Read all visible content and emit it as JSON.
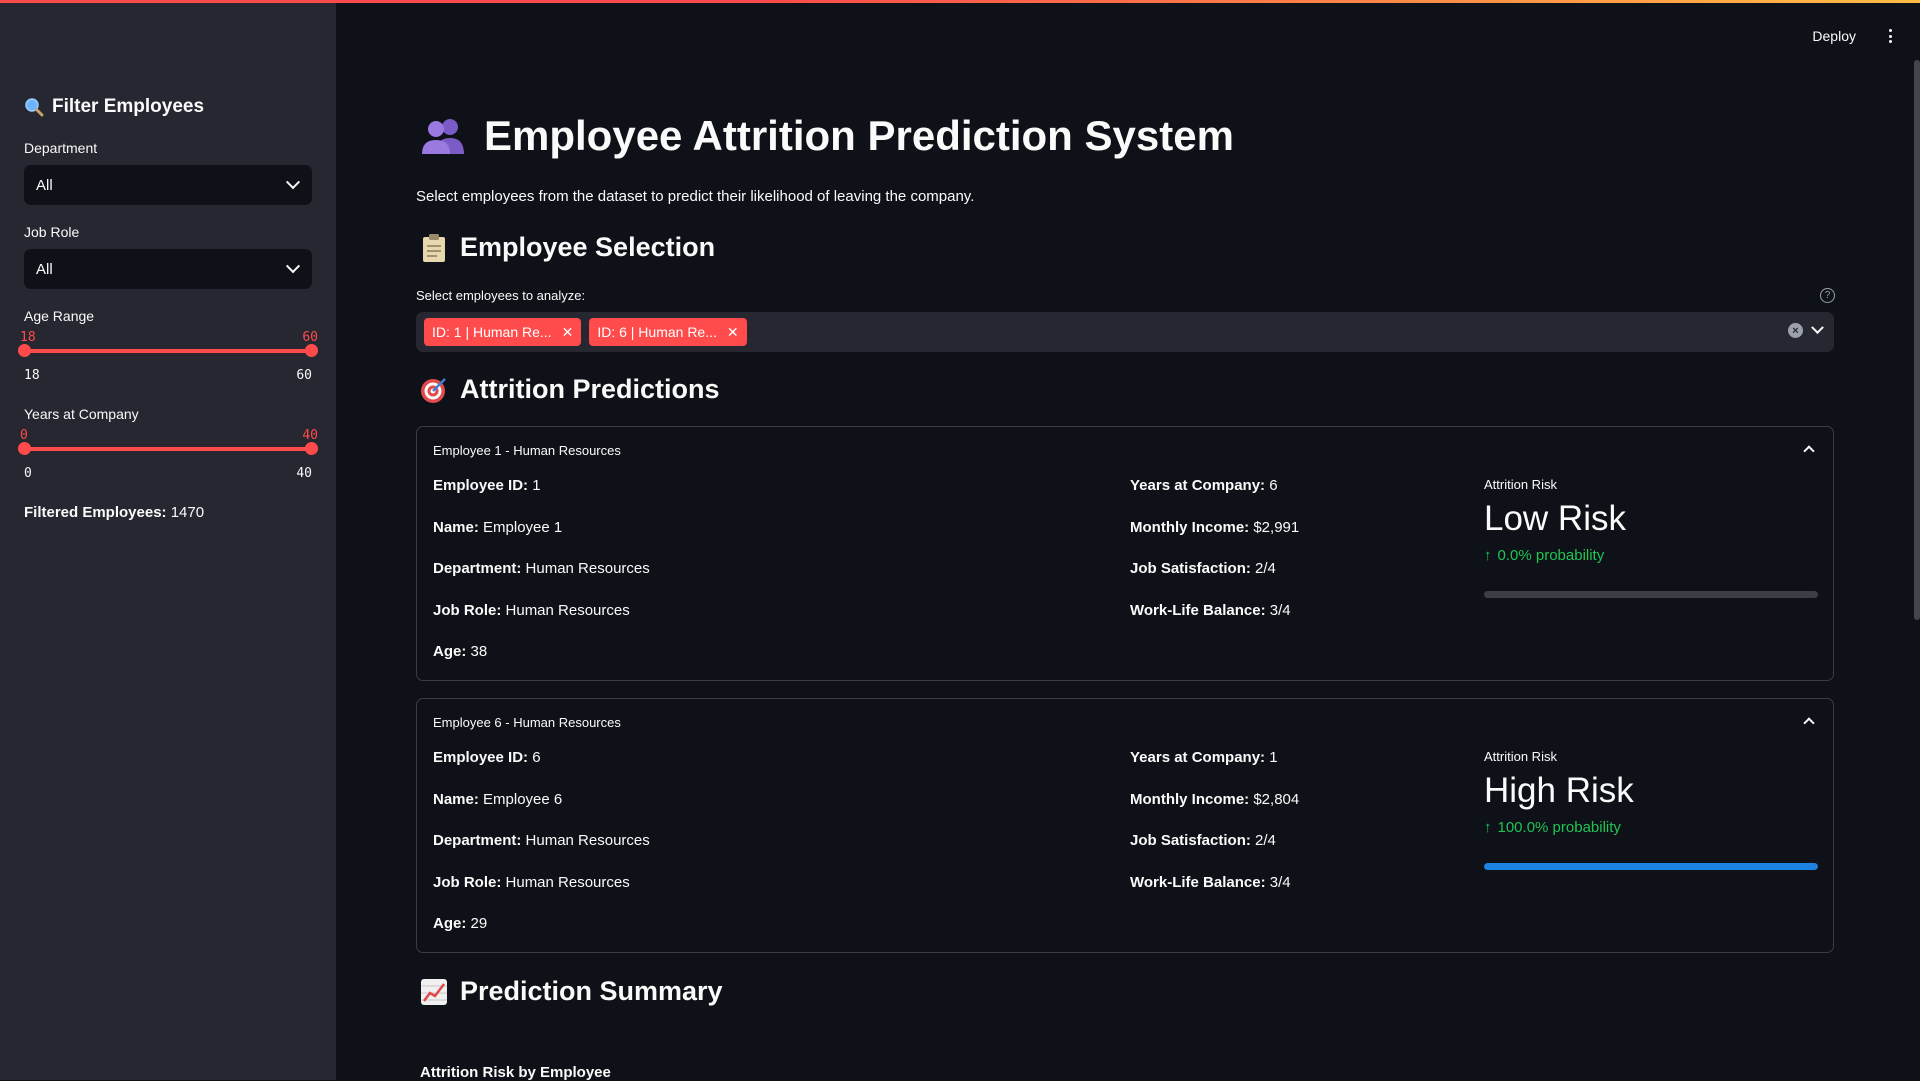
{
  "header": {
    "deploy_label": "Deploy",
    "menu_icon": "kebab-menu-icon"
  },
  "sidebar": {
    "title": "Filter Employees",
    "title_icon": "magnifier-icon",
    "department": {
      "label": "Department",
      "value": "All"
    },
    "job_role": {
      "label": "Job Role",
      "value": "All"
    },
    "age_range": {
      "label": "Age Range",
      "low": "18",
      "high": "60",
      "min": "18",
      "max": "60"
    },
    "years_at_company": {
      "label": "Years at Company",
      "low": "0",
      "high": "40",
      "min": "0",
      "max": "40"
    },
    "filtered_label": "Filtered Employees:",
    "filtered_count": "1470"
  },
  "main": {
    "title": "Employee Attrition Prediction System",
    "title_icon": "people-icon",
    "subtitle": "Select employees from the dataset to predict their likelihood of leaving the company.",
    "selection": {
      "heading": "Employee Selection",
      "heading_icon": "clipboard-icon",
      "label": "Select employees to analyze:",
      "chips": [
        "ID: 1 | Human Re...",
        "ID: 6 | Human Re..."
      ]
    },
    "predictions": {
      "heading": "Attrition Predictions",
      "heading_icon": "target-icon",
      "cards": [
        {
          "header": "Employee 1 - Human Resources",
          "employee_id_label": "Employee ID:",
          "employee_id": "1",
          "name_label": "Name:",
          "name": "Employee 1",
          "department_label": "Department:",
          "department": "Human Resources",
          "job_role_label": "Job Role:",
          "job_role": "Human Resources",
          "age_label": "Age:",
          "age": "38",
          "years_label": "Years at Company:",
          "years": "6",
          "income_label": "Monthly Income:",
          "income": "$2,991",
          "satisfaction_label": "Job Satisfaction:",
          "satisfaction": "2/4",
          "wlb_label": "Work-Life Balance:",
          "wlb": "3/4",
          "metric_label": "Attrition Risk",
          "metric_value": "Low Risk",
          "metric_delta": "0.0% probability",
          "probability": 0.0
        },
        {
          "header": "Employee 6 - Human Resources",
          "employee_id_label": "Employee ID:",
          "employee_id": "6",
          "name_label": "Name:",
          "name": "Employee 6",
          "department_label": "Department:",
          "department": "Human Resources",
          "job_role_label": "Job Role:",
          "job_role": "Human Resources",
          "age_label": "Age:",
          "age": "29",
          "years_label": "Years at Company:",
          "years": "1",
          "income_label": "Monthly Income:",
          "income": "$2,804",
          "satisfaction_label": "Job Satisfaction:",
          "satisfaction": "2/4",
          "wlb_label": "Work-Life Balance:",
          "wlb": "3/4",
          "metric_label": "Attrition Risk",
          "metric_value": "High Risk",
          "metric_delta": "100.0% probability",
          "probability": 1.0
        }
      ]
    },
    "summary": {
      "heading": "Prediction Summary",
      "heading_icon": "chart-increasing-icon",
      "chart_title": "Attrition Risk by Employee"
    }
  },
  "colors": {
    "accent": "#ff4b4b",
    "background": "#0e1117",
    "sidebar": "#262730",
    "delta_green": "#21c354",
    "progress_blue": "#1c83e1"
  }
}
